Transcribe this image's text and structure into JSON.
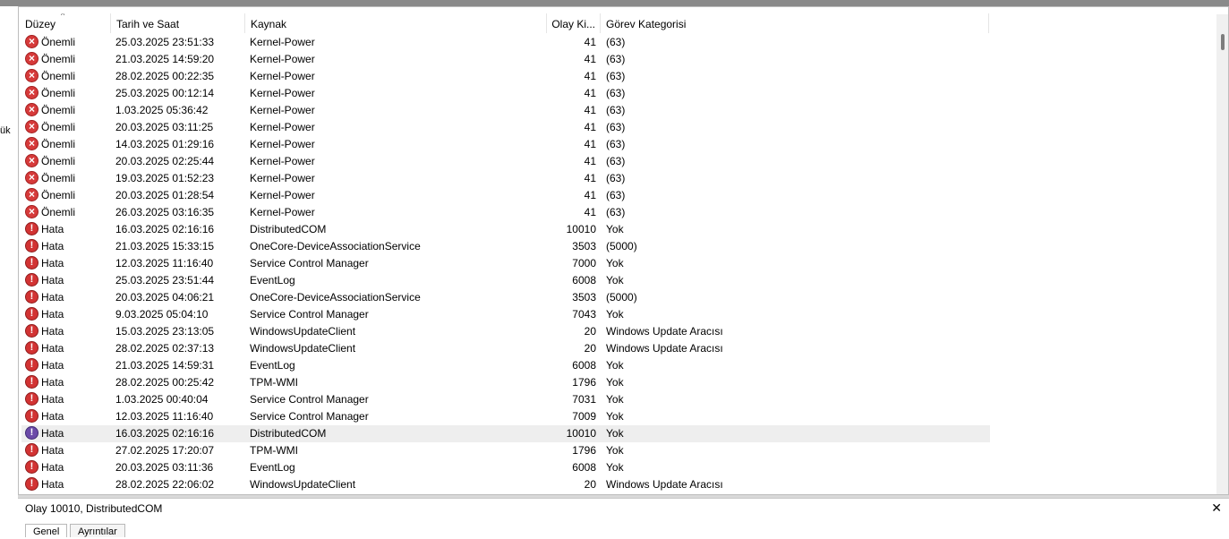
{
  "window": {
    "partial_left_label": "ük"
  },
  "grid": {
    "columns": [
      {
        "key": "level",
        "label": "Düzey",
        "sorted": true
      },
      {
        "key": "date",
        "label": "Tarih ve Saat"
      },
      {
        "key": "source",
        "label": "Kaynak"
      },
      {
        "key": "event_id",
        "label": "Olay Ki..."
      },
      {
        "key": "category",
        "label": "Görev Kategorisi"
      }
    ],
    "sort_indicator": "^",
    "rows": [
      {
        "icon": "critical-icon",
        "level": "Önemli",
        "date": "25.03.2025 23:51:33",
        "source": "Kernel-Power",
        "event_id": "41",
        "category": "(63)"
      },
      {
        "icon": "critical-icon",
        "level": "Önemli",
        "date": "21.03.2025 14:59:20",
        "source": "Kernel-Power",
        "event_id": "41",
        "category": "(63)"
      },
      {
        "icon": "critical-icon",
        "level": "Önemli",
        "date": "28.02.2025 00:22:35",
        "source": "Kernel-Power",
        "event_id": "41",
        "category": "(63)"
      },
      {
        "icon": "critical-icon",
        "level": "Önemli",
        "date": "25.03.2025 00:12:14",
        "source": "Kernel-Power",
        "event_id": "41",
        "category": "(63)"
      },
      {
        "icon": "critical-icon",
        "level": "Önemli",
        "date": "1.03.2025 05:36:42",
        "source": "Kernel-Power",
        "event_id": "41",
        "category": "(63)"
      },
      {
        "icon": "critical-icon",
        "level": "Önemli",
        "date": "20.03.2025 03:11:25",
        "source": "Kernel-Power",
        "event_id": "41",
        "category": "(63)"
      },
      {
        "icon": "critical-icon",
        "level": "Önemli",
        "date": "14.03.2025 01:29:16",
        "source": "Kernel-Power",
        "event_id": "41",
        "category": "(63)"
      },
      {
        "icon": "critical-icon",
        "level": "Önemli",
        "date": "20.03.2025 02:25:44",
        "source": "Kernel-Power",
        "event_id": "41",
        "category": "(63)"
      },
      {
        "icon": "critical-icon",
        "level": "Önemli",
        "date": "19.03.2025 01:52:23",
        "source": "Kernel-Power",
        "event_id": "41",
        "category": "(63)"
      },
      {
        "icon": "critical-icon",
        "level": "Önemli",
        "date": "20.03.2025 01:28:54",
        "source": "Kernel-Power",
        "event_id": "41",
        "category": "(63)"
      },
      {
        "icon": "critical-icon",
        "level": "Önemli",
        "date": "26.03.2025 03:16:35",
        "source": "Kernel-Power",
        "event_id": "41",
        "category": "(63)"
      },
      {
        "icon": "error-icon",
        "level": "Hata",
        "date": "16.03.2025 02:16:16",
        "source": "DistributedCOM",
        "event_id": "10010",
        "category": "Yok"
      },
      {
        "icon": "error-icon",
        "level": "Hata",
        "date": "21.03.2025 15:33:15",
        "source": "OneCore-DeviceAssociationService",
        "event_id": "3503",
        "category": "(5000)"
      },
      {
        "icon": "error-icon",
        "level": "Hata",
        "date": "12.03.2025 11:16:40",
        "source": "Service Control Manager",
        "event_id": "7000",
        "category": "Yok"
      },
      {
        "icon": "error-icon",
        "level": "Hata",
        "date": "25.03.2025 23:51:44",
        "source": "EventLog",
        "event_id": "6008",
        "category": "Yok"
      },
      {
        "icon": "error-icon",
        "level": "Hata",
        "date": "20.03.2025 04:06:21",
        "source": "OneCore-DeviceAssociationService",
        "event_id": "3503",
        "category": "(5000)"
      },
      {
        "icon": "error-icon",
        "level": "Hata",
        "date": "9.03.2025 05:04:10",
        "source": "Service Control Manager",
        "event_id": "7043",
        "category": "Yok"
      },
      {
        "icon": "error-icon",
        "level": "Hata",
        "date": "15.03.2025 23:13:05",
        "source": "WindowsUpdateClient",
        "event_id": "20",
        "category": "Windows Update Aracısı"
      },
      {
        "icon": "error-icon",
        "level": "Hata",
        "date": "28.02.2025 02:37:13",
        "source": "WindowsUpdateClient",
        "event_id": "20",
        "category": "Windows Update Aracısı"
      },
      {
        "icon": "error-icon",
        "level": "Hata",
        "date": "21.03.2025 14:59:31",
        "source": "EventLog",
        "event_id": "6008",
        "category": "Yok"
      },
      {
        "icon": "error-icon",
        "level": "Hata",
        "date": "28.02.2025 00:25:42",
        "source": "TPM-WMI",
        "event_id": "1796",
        "category": "Yok"
      },
      {
        "icon": "error-icon",
        "level": "Hata",
        "date": "1.03.2025 00:40:04",
        "source": "Service Control Manager",
        "event_id": "7031",
        "category": "Yok"
      },
      {
        "icon": "error-icon",
        "level": "Hata",
        "date": "12.03.2025 11:16:40",
        "source": "Service Control Manager",
        "event_id": "7009",
        "category": "Yok"
      },
      {
        "icon": "error-icon",
        "level": "Hata",
        "date": "16.03.2025 02:16:16",
        "source": "DistributedCOM",
        "event_id": "10010",
        "category": "Yok",
        "selected": true
      },
      {
        "icon": "error-icon",
        "level": "Hata",
        "date": "27.02.2025 17:20:07",
        "source": "TPM-WMI",
        "event_id": "1796",
        "category": "Yok"
      },
      {
        "icon": "error-icon",
        "level": "Hata",
        "date": "20.03.2025 03:11:36",
        "source": "EventLog",
        "event_id": "6008",
        "category": "Yok"
      },
      {
        "icon": "error-icon",
        "level": "Hata",
        "date": "28.02.2025 22:06:02",
        "source": "WindowsUpdateClient",
        "event_id": "20",
        "category": "Windows Update Aracısı"
      }
    ]
  },
  "details": {
    "title": "Olay 10010, DistributedCOM",
    "close_glyph": "✕",
    "tabs": [
      "Genel",
      "Ayrıntılar"
    ]
  },
  "colors": {
    "critical": "#d63a3a",
    "error": "#d23333",
    "selected_row": "#eeeeee",
    "selected_icon": "#6b4aa8"
  }
}
